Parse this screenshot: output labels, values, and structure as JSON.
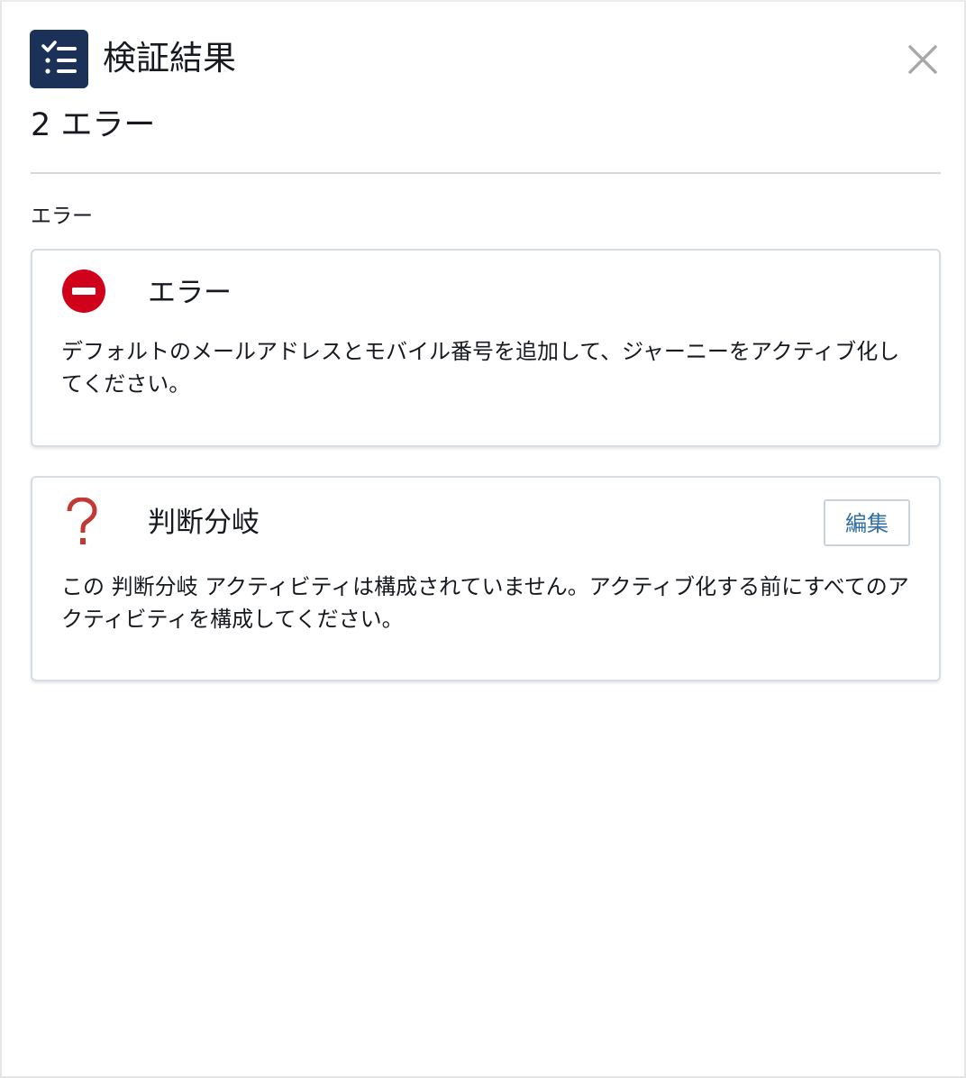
{
  "header": {
    "icon": "checklist-icon",
    "title": "検証結果",
    "close_icon": "close-icon"
  },
  "summary": "2 エラー",
  "section_label": "エラー",
  "cards": [
    {
      "icon": "error-minus-circle-icon",
      "icon_color": "#d0021b",
      "title": "エラー",
      "body": "デフォルトのメールアドレスとモバイル番号を追加して、ジャーニーをアクティブ化してください。"
    },
    {
      "icon": "question-mark-icon",
      "icon_color": "#c23934",
      "title": "判断分岐",
      "edit_label": "編集",
      "body": "この 判断分岐 アクティビティは構成されていません。アクティブ化する前にすべてのアクティビティを構成してください。"
    }
  ],
  "colors": {
    "header_icon_bg": "#1b3158",
    "edit_text": "#2f6fa5"
  }
}
